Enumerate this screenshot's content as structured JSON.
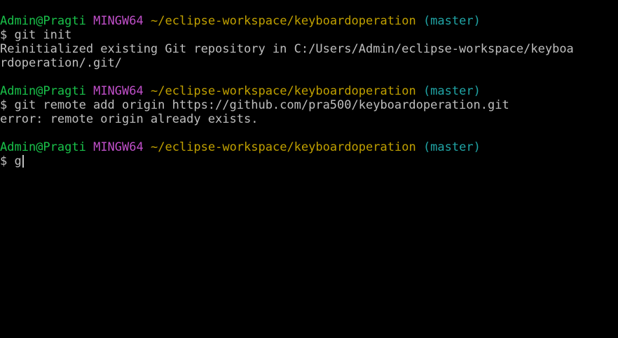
{
  "colors": {
    "background": "#000000",
    "text": "#bfbfbf",
    "user": "#19c24a",
    "host": "#c04fc9",
    "path": "#c0a000",
    "branch": "#20a5a6"
  },
  "blocks": [
    {
      "prompt": {
        "user": "Admin@Pragti",
        "host": "MINGW64",
        "path": "~/eclipse-workspace/keyboardoperation",
        "branch": "(master)"
      },
      "command": "$ git init",
      "output": [
        "Reinitialized existing Git repository in C:/Users/Admin/eclipse-workspace/keyboa",
        "rdoperation/.git/"
      ]
    },
    {
      "prompt": {
        "user": "Admin@Pragti",
        "host": "MINGW64",
        "path": "~/eclipse-workspace/keyboardoperation",
        "branch": "(master)"
      },
      "command": "$ git remote add origin https://github.com/pra500/keyboardoperation.git",
      "output": [
        "error: remote origin already exists."
      ]
    },
    {
      "prompt": {
        "user": "Admin@Pragti",
        "host": "MINGW64",
        "path": "~/eclipse-workspace/keyboardoperation",
        "branch": "(master)"
      },
      "command": "$ g",
      "output": []
    }
  ]
}
